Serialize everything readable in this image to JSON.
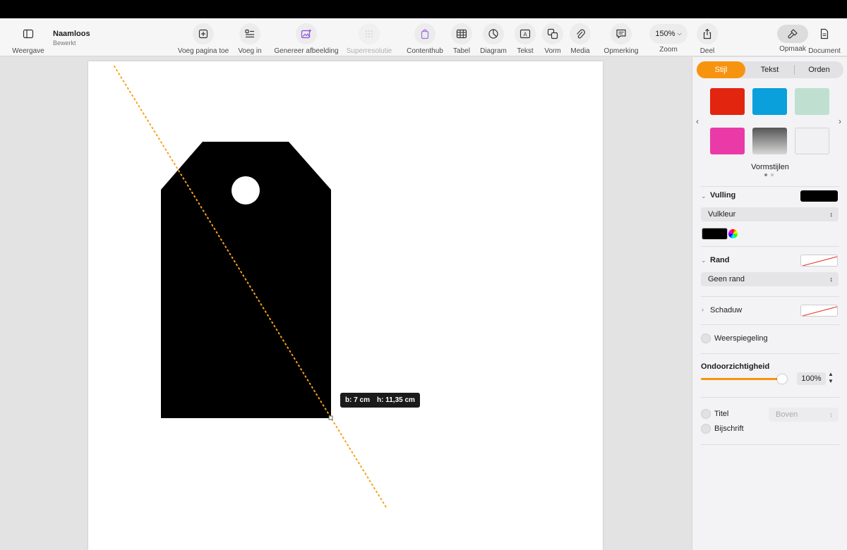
{
  "document": {
    "title": "Naamloos",
    "subtitle": "Bewerkt"
  },
  "toolbar": {
    "view": "Weergave",
    "add_page": "Voeg pagina toe",
    "insert": "Voeg in",
    "generate_image": "Genereer afbeelding",
    "super_resolution": "Superresolutie",
    "content_hub": "Contenthub",
    "table": "Tabel",
    "chart": "Diagram",
    "text": "Tekst",
    "shape": "Vorm",
    "media": "Media",
    "comment": "Opmerking",
    "zoom_value": "150%",
    "zoom": "Zoom",
    "share": "Deel",
    "format": "Opmaak",
    "document": "Document"
  },
  "tooltip": {
    "width": "b: 7 cm",
    "height": "h: 11,35 cm"
  },
  "sidebar": {
    "tabs": [
      "Stijl",
      "Tekst",
      "Orden"
    ],
    "swatches": [
      "#e2250f",
      "#0aa0dc",
      "#bfe0d1",
      "#ea3aa8",
      "gradient",
      "#f1f1f4"
    ],
    "shape_styles_label": "Vormstijlen",
    "fill": {
      "label": "Vulling",
      "type": "Vulkleur",
      "color": "#000000"
    },
    "border": {
      "label": "Rand",
      "type": "Geen rand"
    },
    "shadow": {
      "label": "Schaduw"
    },
    "reflection": {
      "label": "Weerspiegeling"
    },
    "opacity": {
      "label": "Ondoorzichtigheid",
      "value": "100%",
      "level": 1.0
    },
    "title": {
      "label": "Titel",
      "position": "Boven"
    },
    "caption": {
      "label": "Bijschrift"
    }
  },
  "colors": {
    "accent": "#f7940f",
    "shape_fill": "#000000",
    "guide": "#f7a21b"
  }
}
